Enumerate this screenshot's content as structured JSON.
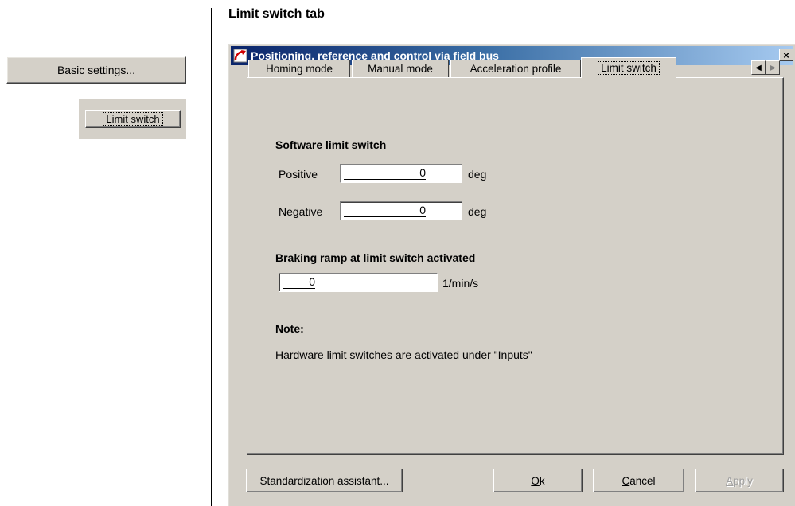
{
  "left": {
    "basic_settings_label": "Basic settings...",
    "limit_switch_label": "Limit switch"
  },
  "heading": "Limit switch tab",
  "dialog": {
    "title": "Positioning, reference and control via field bus",
    "close_glyph": "×",
    "tabs": [
      {
        "label": "Homing mode",
        "active": false
      },
      {
        "label": "Manual mode",
        "active": false
      },
      {
        "label": "Acceleration profile",
        "active": false
      },
      {
        "label": "Limit switch",
        "active": true
      }
    ],
    "scroll_left_glyph": "◀",
    "scroll_right_glyph": "▶",
    "software_limit": {
      "title": "Software limit switch",
      "positive_label": "Positive",
      "positive_value": "0",
      "positive_unit": "deg",
      "negative_label": "Negative",
      "negative_value": "0",
      "negative_unit": "deg"
    },
    "braking": {
      "title": "Braking ramp at limit switch activated",
      "value": "0",
      "unit": "1/min/s"
    },
    "note": {
      "title": "Note:",
      "text": "Hardware limit switches are activated under \"Inputs\""
    },
    "footer": {
      "standardization": "Standardization assistant...",
      "ok_mnemonic": "O",
      "ok_rest": "k",
      "cancel_mnemonic": "C",
      "cancel_rest": "ancel",
      "apply_mnemonic": "A",
      "apply_rest": "pply"
    }
  },
  "colors": {
    "face": "#d4d0c8",
    "title_start": "#0a246a",
    "title_end": "#a6caf0"
  },
  "icons": {
    "app": "gauge-arrow-icon",
    "close": "close-icon",
    "scroll_left": "arrow-left-icon",
    "scroll_right": "arrow-right-icon"
  }
}
